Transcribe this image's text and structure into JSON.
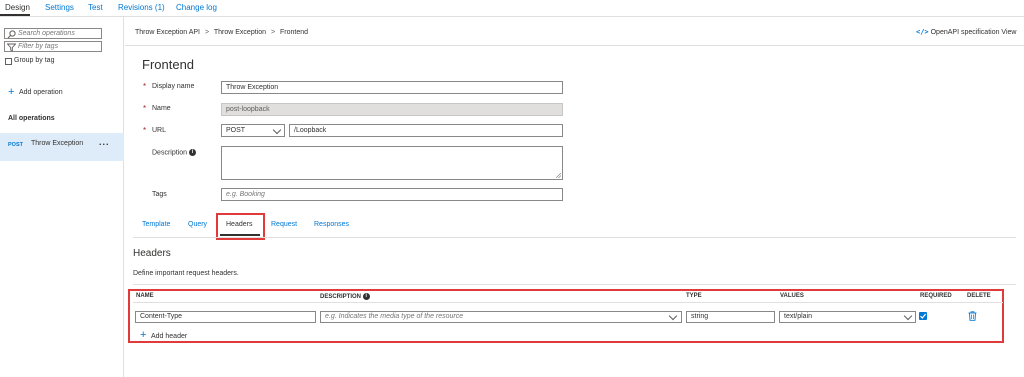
{
  "top_tabs": [
    "Design",
    "Settings",
    "Test",
    "Revisions (1)",
    "Change log"
  ],
  "sidebar": {
    "search_placeholder": "Search operations",
    "filter_placeholder": "Filter by tags",
    "group_by_tag": "Group by tag",
    "add_operation": "Add operation",
    "all_operations": "All operations",
    "operation": {
      "method": "POST",
      "name": "Throw Exception",
      "more": "..."
    }
  },
  "breadcrumb": [
    "Throw Exception API",
    "Throw Exception",
    "Frontend"
  ],
  "breadcrumb_sep": ">",
  "openapi_label": "OpenAPI specification View",
  "form": {
    "title": "Frontend",
    "required_mark": "*",
    "display_name_label": "Display name",
    "display_name_value": "Throw Exception",
    "name_label": "Name",
    "name_value": "post-loopback",
    "url_label": "URL",
    "url_method": "POST",
    "url_path": "/Loopback",
    "description_label": "Description",
    "tags_label": "Tags",
    "tags_placeholder": "e.g. Booking"
  },
  "tabs": [
    "Template",
    "Query",
    "Headers",
    "Request",
    "Responses"
  ],
  "active_tab": "Headers",
  "headers_section": {
    "title": "Headers",
    "description": "Define important request headers.",
    "columns": [
      "NAME",
      "DESCRIPTION",
      "TYPE",
      "VALUES",
      "REQUIRED",
      "DELETE"
    ],
    "row": {
      "name": "Content-Type",
      "description_placeholder": "e.g. Indicates the media type of the resource",
      "type": "string",
      "values": "text/plain",
      "required": true
    },
    "add_header": "Add header"
  },
  "colors": {
    "accent": "#0078d4",
    "highlight": "#e03a3a",
    "selected_row": "#deecf9"
  }
}
